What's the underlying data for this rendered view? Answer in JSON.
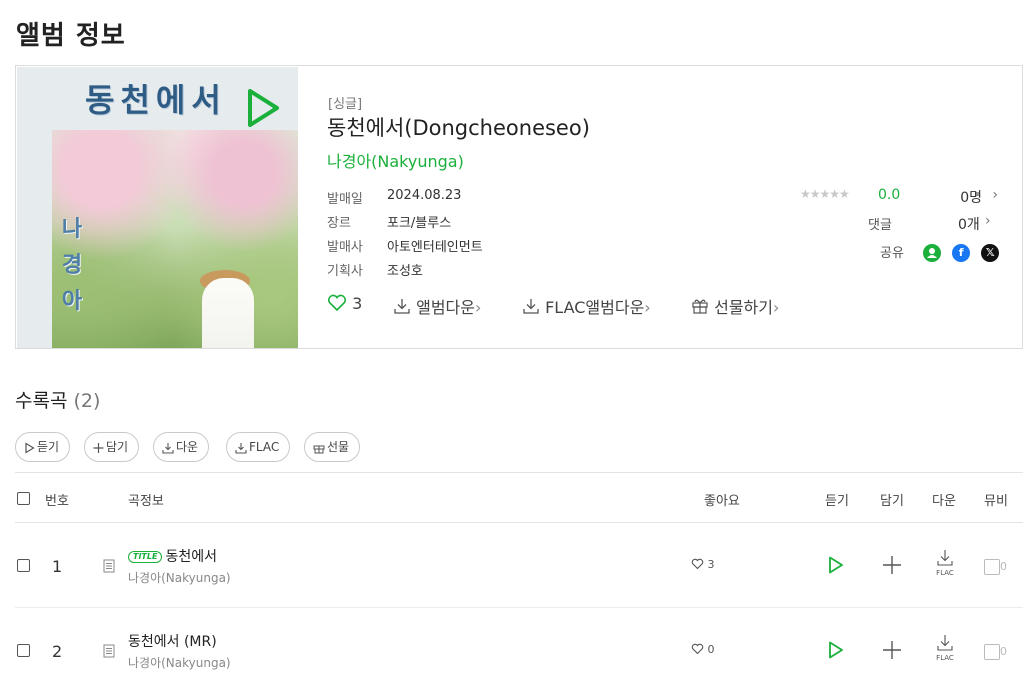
{
  "page_title": "앨범 정보",
  "album": {
    "cover": {
      "title_text": "동천에서",
      "artist_text": [
        "나",
        "경",
        "아"
      ]
    },
    "type": "[싱글]",
    "name": "동천에서(Dongcheoneseo)",
    "artist": "나경아(Nakyunga)",
    "meta": [
      {
        "label": "발매일",
        "value": "2024.08.23"
      },
      {
        "label": "장르",
        "value": "포크/블루스"
      },
      {
        "label": "발매사",
        "value": "아토엔터테인먼트"
      },
      {
        "label": "기획사",
        "value": "조성호"
      }
    ],
    "rating": {
      "stars": "★★★★★",
      "score": "0.0",
      "count": "0명"
    },
    "comments": {
      "label": "댓글",
      "count": "0개"
    },
    "share": {
      "label": "공유",
      "icons": [
        "profile-icon",
        "facebook-icon",
        "x-icon"
      ]
    },
    "actions": {
      "like_count": "3",
      "album_download": "앨범다운",
      "flac_download": "FLAC앨범다운",
      "gift": "선물하기"
    }
  },
  "tracks_section": {
    "title": "수록곡",
    "count": "(2)",
    "buttons": {
      "listen": "듣기",
      "add": "담기",
      "download": "다운",
      "flac": "FLAC",
      "gift": "선물"
    },
    "headers": {
      "number": "번호",
      "info": "곡정보",
      "likes": "좋아요",
      "listen": "듣기",
      "add": "담기",
      "download": "다운",
      "mv": "뮤비"
    },
    "rows": [
      {
        "number": "1",
        "badge": "TITLE",
        "title": "동천에서",
        "artist": "나경아(Nakyunga)",
        "likes": "3",
        "flac": "FLAC",
        "mv": "0"
      },
      {
        "number": "2",
        "badge": "",
        "title": "동천에서 (MR)",
        "artist": "나경아(Nakyunga)",
        "likes": "0",
        "flac": "FLAC",
        "mv": "0"
      }
    ]
  },
  "colors": {
    "accent": "#1ab03b",
    "border": "#dcdcdc",
    "facebook": "#1877f2",
    "profile": "#1ab03b",
    "x": "#111111"
  }
}
